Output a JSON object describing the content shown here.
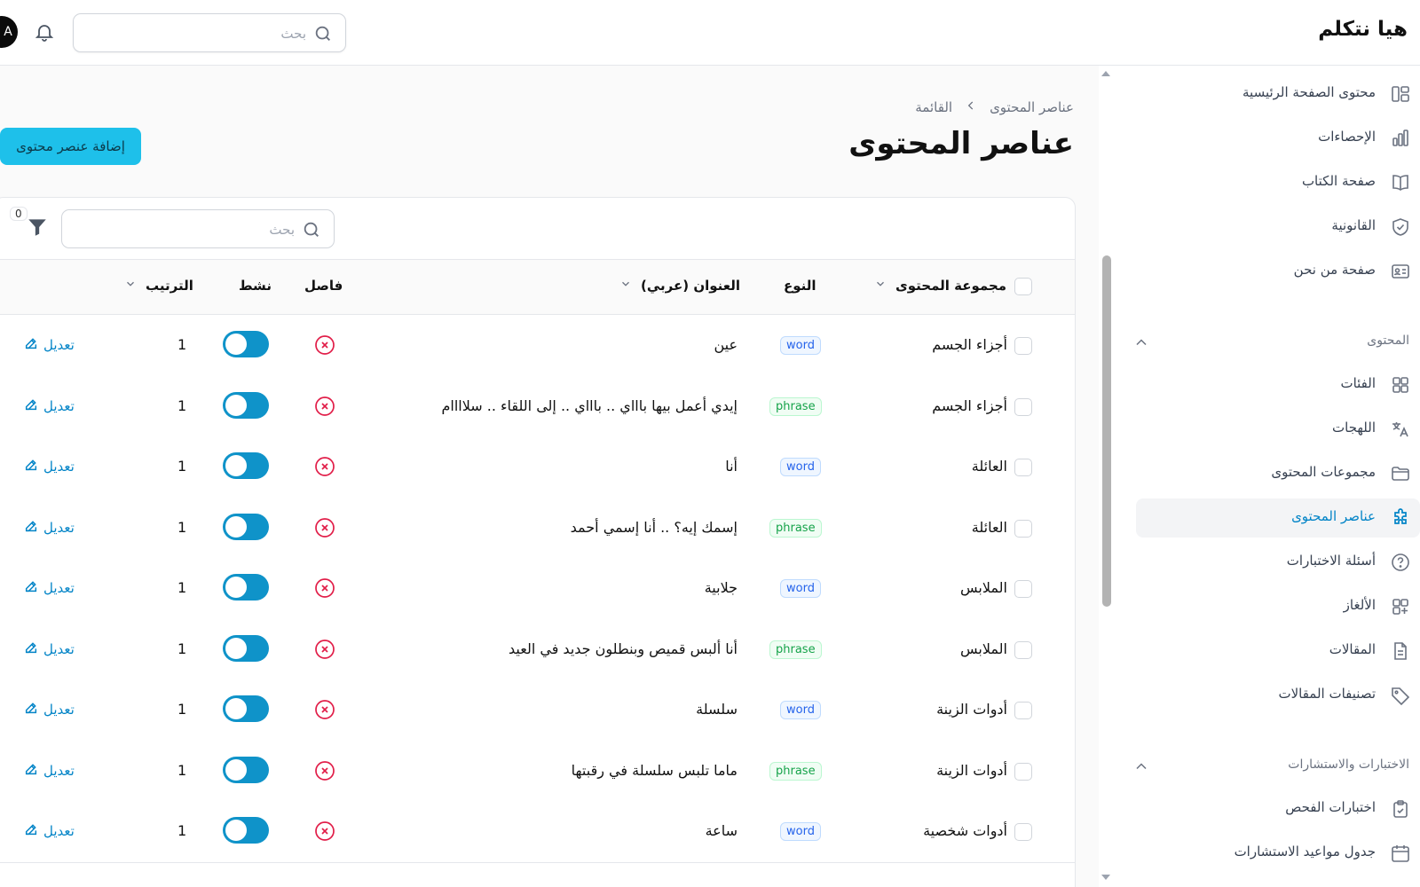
{
  "app": {
    "title": "هيا نتكلم",
    "search_placeholder": "بحث",
    "avatar_initial": "A"
  },
  "sidebar": {
    "items_top": [
      {
        "label": "محتوى الصفحة الرئيسية",
        "icon": "layout-icon"
      },
      {
        "label": "الإحصاءات",
        "icon": "bar-chart-icon"
      },
      {
        "label": "صفحة الكتاب",
        "icon": "book-icon"
      },
      {
        "label": "القانونية",
        "icon": "shield-check-icon"
      },
      {
        "label": "صفحة من نحن",
        "icon": "id-card-icon"
      }
    ],
    "group_content": "المحتوى",
    "items_content": [
      {
        "label": "الفئات",
        "icon": "grid-icon"
      },
      {
        "label": "اللهجات",
        "icon": "translate-icon"
      },
      {
        "label": "مجموعات المحتوى",
        "icon": "folder-icon"
      },
      {
        "label": "عناصر المحتوى",
        "icon": "puzzle-icon",
        "active": true
      },
      {
        "label": "أسئلة الاختبارات",
        "icon": "question-circle-icon"
      },
      {
        "label": "الألغاز",
        "icon": "grid-plus-icon"
      },
      {
        "label": "المقالات",
        "icon": "document-icon"
      },
      {
        "label": "تصنيفات المقالات",
        "icon": "tag-icon"
      }
    ],
    "group_tests": "الاختبارات والاستشارات",
    "items_tests": [
      {
        "label": "اختبارات الفحص",
        "icon": "clipboard-check-icon"
      },
      {
        "label": "جدول مواعيد الاستشارات",
        "icon": "calendar-icon"
      }
    ]
  },
  "main": {
    "breadcrumb": [
      "عناصر المحتوى",
      "القائمة"
    ],
    "title": "عناصر المحتوى",
    "add_button": "إضافة عنصر محتوى",
    "table_search_placeholder": "بحث",
    "filter_count": "0"
  },
  "table": {
    "headers": {
      "group": "مجموعة المحتوى",
      "type": "النوع",
      "title": "العنوان (عربي)",
      "separator": "فاصل",
      "active": "نشط",
      "order": "الترتيب"
    },
    "edit_label": "تعديل",
    "rows": [
      {
        "group": "أجزاء الجسم",
        "type": "word",
        "title": "عين",
        "order": "1"
      },
      {
        "group": "أجزاء الجسم",
        "type": "phrase",
        "title": "إيدي أعمل بيها باااي .. باااي .. إلى اللقاء .. سلاااام",
        "order": "1"
      },
      {
        "group": "العائلة",
        "type": "word",
        "title": "أنا",
        "order": "1"
      },
      {
        "group": "العائلة",
        "type": "phrase",
        "title": "إسمك إيه؟ .. أنا إسمي أحمد",
        "order": "1"
      },
      {
        "group": "الملابس",
        "type": "word",
        "title": "جلابية",
        "order": "1"
      },
      {
        "group": "الملابس",
        "type": "phrase",
        "title": "أنا ألبس قميص وبنطلون جديد في العيد",
        "order": "1"
      },
      {
        "group": "أدوات الزينة",
        "type": "word",
        "title": "سلسلة",
        "order": "1"
      },
      {
        "group": "أدوات الزينة",
        "type": "phrase",
        "title": "ماما تلبس سلسلة في رقبتها",
        "order": "1"
      },
      {
        "group": "أدوات شخصية",
        "type": "word",
        "title": "ساعة",
        "order": "1"
      }
    ]
  },
  "colors": {
    "accent": "#1ec0ea",
    "toggle_on": "#0f93c9",
    "link": "#0284c7",
    "danger": "#e11d48"
  }
}
